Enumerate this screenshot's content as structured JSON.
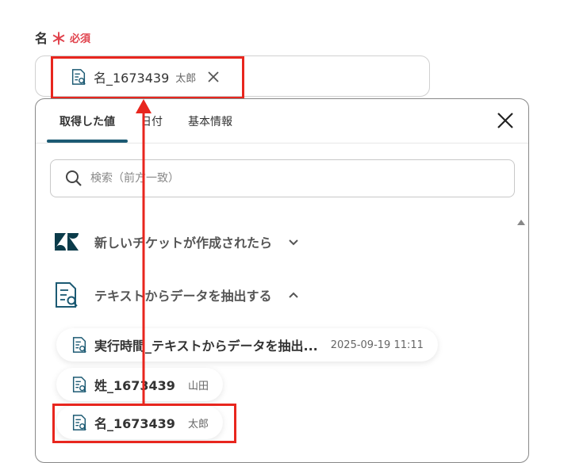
{
  "field": {
    "label": "名",
    "required_mark": "＊",
    "required_text": "必須",
    "chip": {
      "value": "名_1673439",
      "sub": "太郎",
      "remove_icon": "close-icon"
    }
  },
  "panel": {
    "tabs": [
      {
        "label": "取得した値",
        "active": true
      },
      {
        "label": "日付",
        "active": false
      },
      {
        "label": "基本情報",
        "active": false
      }
    ],
    "search_placeholder": "検索（前方一致）",
    "apps": [
      {
        "label": "新しいチケットが作成されたら",
        "icon": "zendesk-logo",
        "expanded": false
      },
      {
        "label": "テキストからデータを抽出する",
        "icon": "document-search-icon",
        "expanded": true
      }
    ],
    "items": [
      {
        "value": "実行時間_テキストからデータを抽出...",
        "sub": "2025-09-19 11:11"
      },
      {
        "value": "姓_1673439",
        "sub": "山田"
      },
      {
        "value": "名_1673439",
        "sub": "太郎"
      }
    ]
  },
  "colors": {
    "accent": "#1c5a73",
    "highlight": "#e8261e",
    "required": "#e0424c"
  }
}
